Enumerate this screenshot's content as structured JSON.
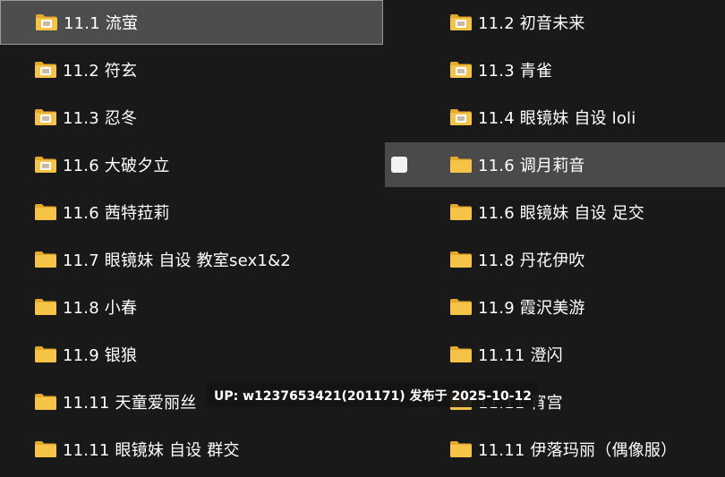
{
  "colors": {
    "background": "#191919",
    "selected_bg": "#4d4d4d",
    "hover_bg": "#4a4a4a",
    "folder": "#f5c447",
    "folder_dark": "#e2a92c"
  },
  "icons": {
    "folder": "folder-icon",
    "folder_thumb": "folder-thumbnail-icon",
    "checkbox": "checkbox-icon"
  },
  "left_items": [
    {
      "label": "11.1 流萤",
      "state": "selected",
      "thumb": true
    },
    {
      "label": "11.2 符玄",
      "state": "",
      "thumb": true
    },
    {
      "label": "11.3 忍冬",
      "state": "",
      "thumb": true
    },
    {
      "label": "11.6 大破夕立",
      "state": "",
      "thumb": true
    },
    {
      "label": "11.6 茜特菈莉",
      "state": "",
      "thumb": false
    },
    {
      "label": "11.7 眼镜妹 自设 教室sex1&2",
      "state": "",
      "thumb": false
    },
    {
      "label": "11.8 小春",
      "state": "",
      "thumb": false
    },
    {
      "label": "11.9 银狼",
      "state": "",
      "thumb": false
    },
    {
      "label": "11.11 天童爱丽丝",
      "state": "",
      "thumb": false
    },
    {
      "label": "11.11 眼镜妹 自设 群交",
      "state": "",
      "thumb": false
    }
  ],
  "right_items": [
    {
      "label": "11.2 初音未来",
      "state": "",
      "thumb": true
    },
    {
      "label": "11.3 青雀",
      "state": "",
      "thumb": true
    },
    {
      "label": "11.4 眼镜妹 自设 loli",
      "state": "",
      "thumb": true
    },
    {
      "label": "11.6 调月莉音",
      "state": "hovered",
      "thumb": false
    },
    {
      "label": "11.6 眼镜妹 自设 足交",
      "state": "",
      "thumb": false
    },
    {
      "label": "11.8 丹花伊吹",
      "state": "",
      "thumb": false
    },
    {
      "label": "11.9 霞沢美游",
      "state": "",
      "thumb": false
    },
    {
      "label": "11.11 澄闪",
      "state": "",
      "thumb": false
    },
    {
      "label": "11.11 宵宫",
      "state": "",
      "thumb": false
    },
    {
      "label": "11.11 伊落玛丽（偶像服）",
      "state": "",
      "thumb": false
    }
  ],
  "tooltip": {
    "text": "UP: w1237653421(201171) 发布于 2025-10-12"
  }
}
